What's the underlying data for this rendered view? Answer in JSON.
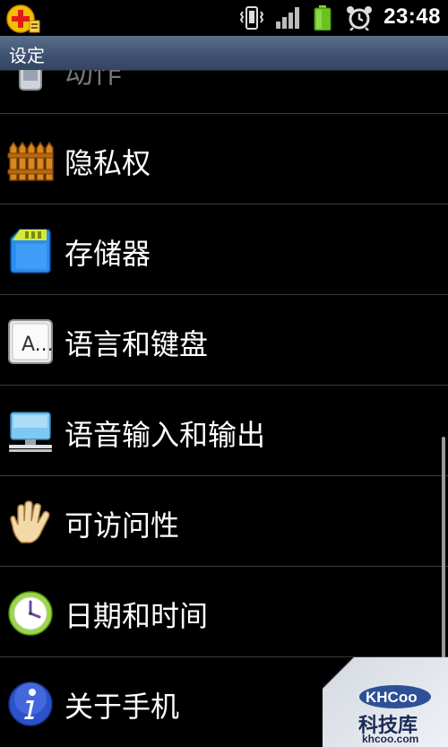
{
  "status_bar": {
    "time": "23:48",
    "icons": [
      "notification-plus-icon",
      "vibrate-icon",
      "signal-icon",
      "battery-icon",
      "alarm-clock-icon"
    ]
  },
  "title_bar": {
    "title": "设定"
  },
  "settings": {
    "items": [
      {
        "label": "动作",
        "icon": "motion-phone-icon"
      },
      {
        "label": "隐私权",
        "icon": "fence-icon"
      },
      {
        "label": "存储器",
        "icon": "sd-card-icon"
      },
      {
        "label": "语言和键盘",
        "icon": "keyboard-key-icon"
      },
      {
        "label": "语音输入和输出",
        "icon": "monitor-icon"
      },
      {
        "label": "可访问性",
        "icon": "hand-icon"
      },
      {
        "label": "日期和时间",
        "icon": "clock-icon"
      },
      {
        "label": "关于手机",
        "icon": "info-icon"
      }
    ],
    "keyboard_key_glyph": "A..."
  },
  "watermark": {
    "logo": "KHCoo",
    "name": "科技库",
    "url": "khcoo.com"
  },
  "colors": {
    "background": "#000000",
    "title_bar": "#3e5170",
    "divider": "#3a3a3a",
    "text": "#ffffff"
  }
}
